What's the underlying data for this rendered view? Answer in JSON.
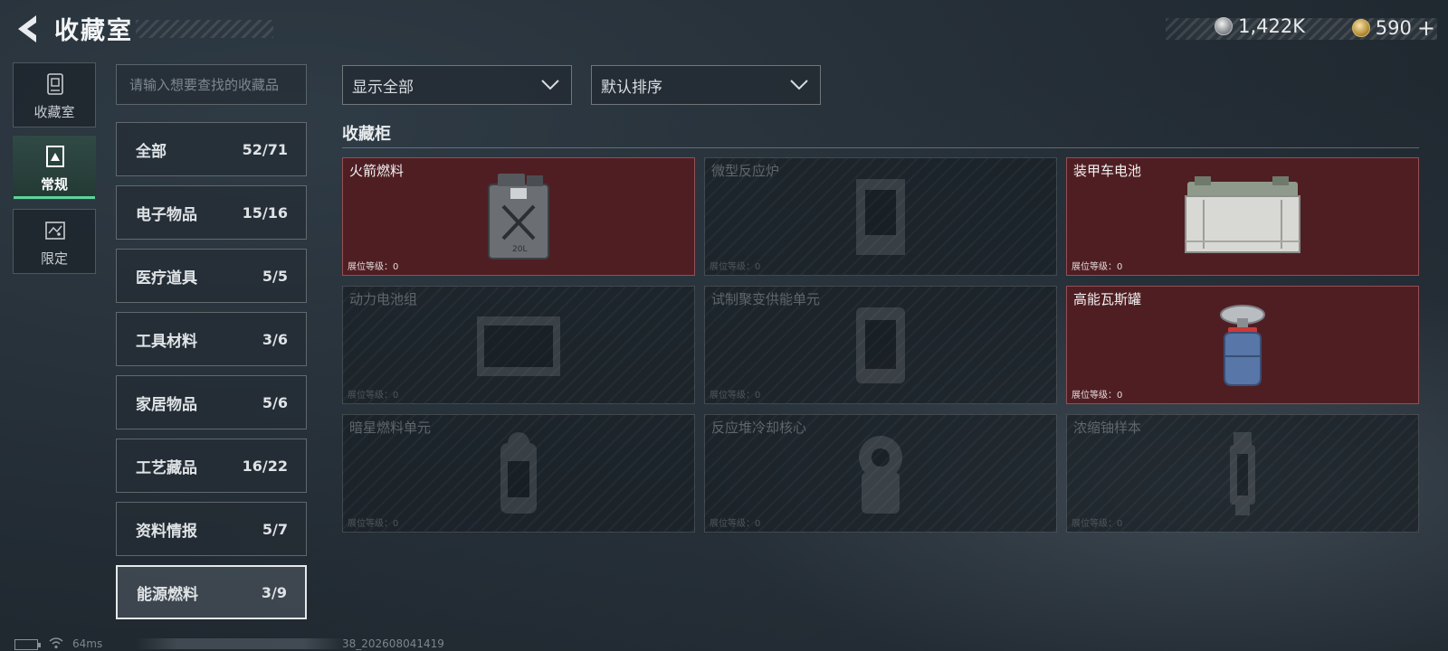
{
  "header": {
    "title": "收藏室",
    "currencies": [
      {
        "icon": "silver-coin-icon",
        "value": "1,422K"
      },
      {
        "icon": "gold-coin-icon",
        "value": "590"
      }
    ],
    "plus": "+"
  },
  "rail": [
    {
      "label": "收藏室",
      "icon": "collection-room-icon",
      "active": false
    },
    {
      "label": "常规",
      "icon": "regular-icon",
      "active": true
    },
    {
      "label": "限定",
      "icon": "limited-icon",
      "active": false
    }
  ],
  "search": {
    "placeholder": "请输入想要查找的收藏品"
  },
  "categories": [
    {
      "name": "全部",
      "count": "52/71"
    },
    {
      "name": "电子物品",
      "count": "15/16"
    },
    {
      "name": "医疗道具",
      "count": "5/5"
    },
    {
      "name": "工具材料",
      "count": "3/6"
    },
    {
      "name": "家居物品",
      "count": "5/6"
    },
    {
      "name": "工艺藏品",
      "count": "16/22"
    },
    {
      "name": "资料情报",
      "count": "5/7"
    },
    {
      "name": "能源燃料",
      "count": "3/9",
      "active": true
    }
  ],
  "filters": {
    "show": "显示全部",
    "sort": "默认排序"
  },
  "section": {
    "title": "收藏柜"
  },
  "level_label": "展位等级：0",
  "items": [
    {
      "name": "火箭燃料",
      "owned": true,
      "icon": "fuel-canister-icon"
    },
    {
      "name": "微型反应炉",
      "owned": false,
      "icon": "micro-reactor-icon"
    },
    {
      "name": "装甲车电池",
      "owned": true,
      "icon": "vehicle-battery-icon"
    },
    {
      "name": "动力电池组",
      "owned": false,
      "icon": "battery-pack-icon"
    },
    {
      "name": "试制聚变供能单元",
      "owned": false,
      "icon": "fusion-unit-icon"
    },
    {
      "name": "高能瓦斯罐",
      "owned": true,
      "icon": "gas-canister-icon"
    },
    {
      "name": "暗星燃料单元",
      "owned": false,
      "icon": "fuel-cell-icon"
    },
    {
      "name": "反应堆冷却核心",
      "owned": false,
      "icon": "cooling-core-icon"
    },
    {
      "name": "浓缩铀样本",
      "owned": false,
      "icon": "uranium-sample-icon"
    }
  ],
  "footer": {
    "ping": "64ms",
    "build": "38_202608041419"
  },
  "colors": {
    "accent": "#5fd39a",
    "owned_card": "#4f1e23"
  }
}
